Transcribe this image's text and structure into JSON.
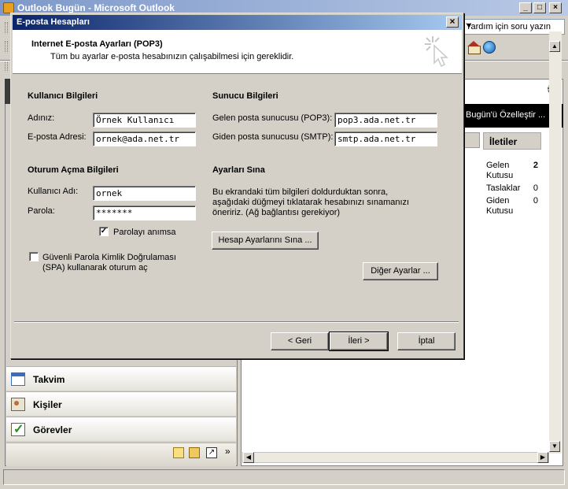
{
  "background_window": {
    "title": "Outlook Bugün - Microsoft Outlook",
    "help_placeholder": "Yardım için soru yazın",
    "customize_link": "Bugün'ü Özelleştir ...",
    "folders_header": "İletiler",
    "folders": [
      {
        "name": "Gelen Kutusu",
        "count": "2"
      },
      {
        "name": "Taslaklar",
        "count": "0"
      },
      {
        "name": "Giden Kutusu",
        "count": "0"
      }
    ],
    "nav": [
      {
        "label": "Takvim",
        "icon": "calendar-icon"
      },
      {
        "label": "Kişiler",
        "icon": "contacts-icon"
      },
      {
        "label": "Görevler",
        "icon": "tasks-icon"
      }
    ]
  },
  "dialog": {
    "title": "E-posta Hesapları",
    "header_title": "Internet E-posta Ayarları (POP3)",
    "header_subtitle": "Tüm bu ayarlar e-posta hesabınızın çalışabilmesi için gereklidir.",
    "user_section": {
      "title": "Kullanıcı Bilgileri",
      "name_label": "Adınız:",
      "name_value": "Örnek Kullanıcı",
      "email_label": "E-posta Adresi:",
      "email_value": "ornek@ada.net.tr"
    },
    "server_section": {
      "title": "Sunucu Bilgileri",
      "incoming_label": "Gelen posta sunucusu (POP3):",
      "incoming_value": "pop3.ada.net.tr",
      "outgoing_label": "Giden posta sunucusu (SMTP):",
      "outgoing_value": "smtp.ada.net.tr"
    },
    "login_section": {
      "title": "Oturum Açma Bilgileri",
      "username_label": "Kullanıcı Adı:",
      "username_value": "ornek",
      "password_label": "Parola:",
      "password_value": "*******",
      "remember_label": "Parolayı anımsa",
      "remember_checked": true,
      "spa_label_line1": "Güvenli Parola Kimlik Doğrulaması",
      "spa_label_line2": "(SPA) kullanarak oturum aç",
      "spa_checked": false
    },
    "test_section": {
      "title": "Ayarları Sına",
      "description_line1": "Bu ekrandaki tüm bilgileri doldurduktan sonra,",
      "description_line2": "aşağıdaki düğmeyi tıklatarak hesabınızı sınamanızı",
      "description_line3": "öneririz. (Ağ bağlantısı gerekiyor)",
      "test_button": "Hesap Ayarlarını Sına ...",
      "more_button": "Diğer Ayarlar ..."
    },
    "footer": {
      "back": "< Geri",
      "next": "İleri >",
      "cancel": "İptal"
    }
  }
}
